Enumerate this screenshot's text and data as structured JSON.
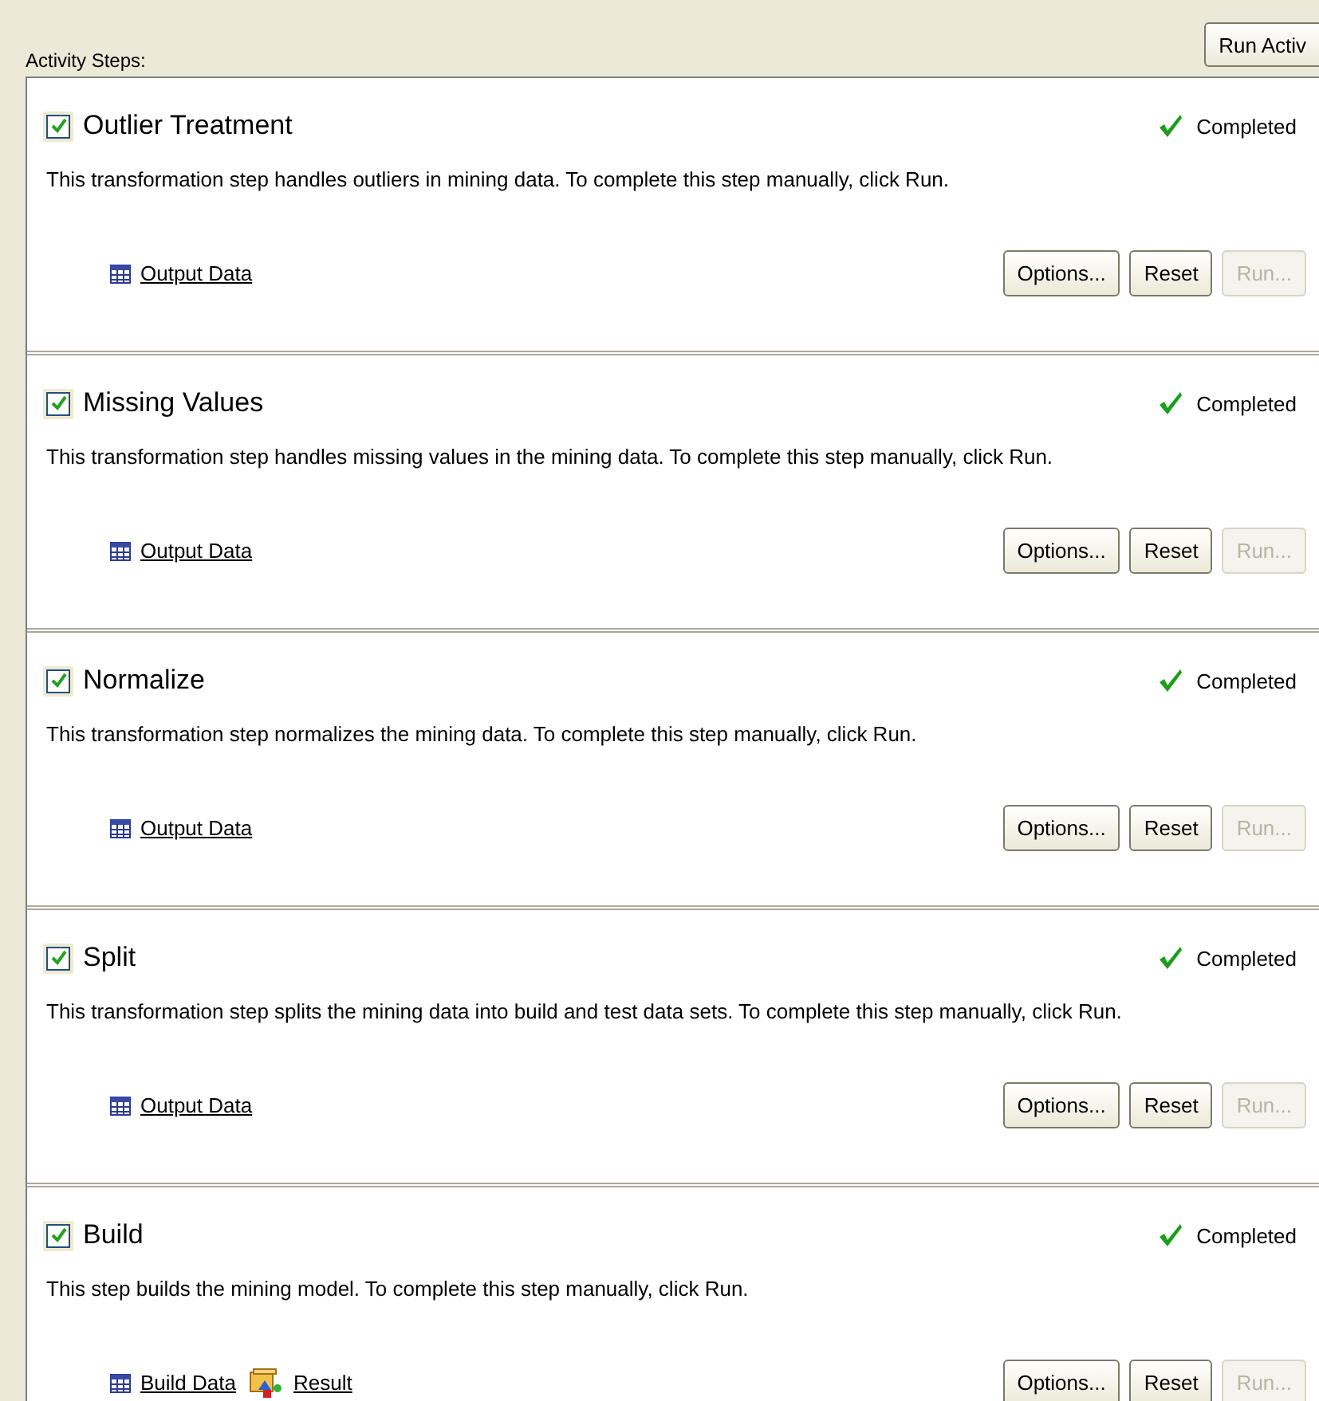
{
  "header": {
    "label": "Activity Steps:",
    "run_button": "Run Activ"
  },
  "steps": [
    {
      "title": "Outlier Treatment",
      "checked": true,
      "status": "Completed",
      "description": "This transformation step handles outliers in mining data. To complete this step manually, click Run.",
      "links": [
        {
          "label": "Output Data",
          "kind": "table"
        }
      ],
      "buttons": [
        {
          "label": "Options...",
          "disabled": false
        },
        {
          "label": "Reset",
          "disabled": false
        },
        {
          "label": "Run...",
          "disabled": true
        }
      ]
    },
    {
      "title": "Missing Values",
      "checked": true,
      "status": "Completed",
      "description": "This transformation step handles missing values in the mining data. To complete this step manually, click Run.",
      "links": [
        {
          "label": "Output Data",
          "kind": "table"
        }
      ],
      "buttons": [
        {
          "label": "Options...",
          "disabled": false
        },
        {
          "label": "Reset",
          "disabled": false
        },
        {
          "label": "Run...",
          "disabled": true
        }
      ]
    },
    {
      "title": "Normalize",
      "checked": true,
      "status": "Completed",
      "description": "This transformation step normalizes the mining data. To complete this step manually, click Run.",
      "links": [
        {
          "label": "Output Data",
          "kind": "table"
        }
      ],
      "buttons": [
        {
          "label": "Options...",
          "disabled": false
        },
        {
          "label": "Reset",
          "disabled": false
        },
        {
          "label": "Run...",
          "disabled": true
        }
      ]
    },
    {
      "title": "Split",
      "checked": true,
      "status": "Completed",
      "description": "This transformation step splits the mining data into build and test data sets. To complete this step manually, click Run.",
      "links": [
        {
          "label": "Output Data",
          "kind": "table"
        }
      ],
      "buttons": [
        {
          "label": "Options...",
          "disabled": false
        },
        {
          "label": "Reset",
          "disabled": false
        },
        {
          "label": "Run...",
          "disabled": true
        }
      ]
    },
    {
      "title": "Build",
      "checked": true,
      "status": "Completed",
      "description": "This step builds the mining model. To complete this step manually, click Run.",
      "links": [
        {
          "label": "Build Data",
          "kind": "table"
        },
        {
          "label": "Result",
          "kind": "result"
        }
      ],
      "buttons": [
        {
          "label": "Options...",
          "disabled": false
        },
        {
          "label": "Reset",
          "disabled": false
        },
        {
          "label": "Run...",
          "disabled": true
        }
      ]
    }
  ]
}
